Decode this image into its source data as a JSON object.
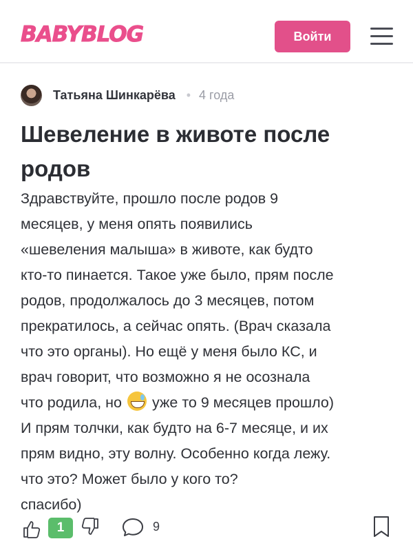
{
  "header": {
    "logo": "BABYBLOG",
    "login_label": "Войти"
  },
  "post": {
    "author": "Татьяна Шинкарёва",
    "time": "4 года",
    "title_lines": [
      "Шевеление в животе после",
      "родов"
    ],
    "body_lines": [
      "Здравствуйте, прошло после родов 9",
      "месяцев, у меня опять появились",
      "«шевеления малыша» в животе, как будто",
      "кто-то пинается. Такое уже было, прям после",
      "родов, продолжалось до 3 месяцев, потом",
      "прекратилось, а сейчас опять. (Врач сказала",
      "что это органы). Но ещё у меня было КС, и",
      "врач говорит, что возможно я не осознала"
    ],
    "body_line_emoji_before": "что родила, но",
    "body_line_emoji_after": "уже то 9 месяцев прошло)",
    "body_lines_tail": [
      "И прям толчки, как будто на 6-7 месяце, и их",
      "прям видно, эту волну. Особенно когда лежу.",
      "что это? Может было у кого то?",
      "спасибо)"
    ],
    "emoji_icon": "grinning-sweat-emoji"
  },
  "actions": {
    "likes": "1",
    "comments": "9"
  },
  "colors": {
    "brand": "#e2508a",
    "like_badge": "#5bbd6b"
  }
}
